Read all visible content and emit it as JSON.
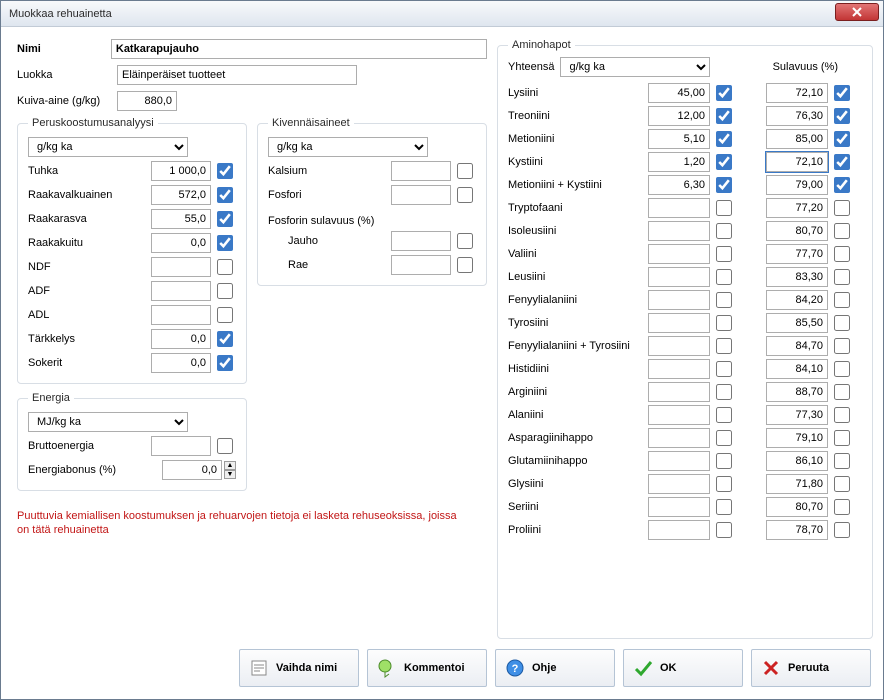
{
  "window": {
    "title": "Muokkaa rehuainetta"
  },
  "header": {
    "name_label": "Nimi",
    "class_label": "Luokka",
    "dm_label": "Kuiva-aine (g/kg)",
    "name_value": "Katkarapujauho",
    "class_value": "Eläinperäiset tuotteet",
    "dm_value": "880,0"
  },
  "basic": {
    "legend": "Peruskoostumusanalyysi",
    "unit": "g/kg ka",
    "rows": [
      {
        "label": "Tuhka",
        "val": "1 000,0",
        "chk": true
      },
      {
        "label": "Raakavalkuainen",
        "val": "572,0",
        "chk": true
      },
      {
        "label": "Raakarasva",
        "val": "55,0",
        "chk": true
      },
      {
        "label": "Raakakuitu",
        "val": "0,0",
        "chk": true
      },
      {
        "label": "NDF",
        "val": "",
        "chk": false,
        "ro": true
      },
      {
        "label": "ADF",
        "val": "",
        "chk": false,
        "ro": true
      },
      {
        "label": "ADL",
        "val": "",
        "chk": false,
        "ro": true
      },
      {
        "label": "Tärkkelys",
        "val": "0,0",
        "chk": true
      },
      {
        "label": "Sokerit",
        "val": "0,0",
        "chk": true
      }
    ]
  },
  "energy": {
    "legend": "Energia",
    "unit": "MJ/kg ka",
    "rows": [
      {
        "label": "Bruttoenergia",
        "val": "",
        "chk": false,
        "ro": true
      }
    ],
    "bonus_label": "Energiabonus (%)",
    "bonus_val": "0,0"
  },
  "minerals": {
    "legend": "Kivennäisaineet",
    "unit": "g/kg ka",
    "rows": [
      {
        "label": "Kalsium",
        "val": "",
        "chk": false,
        "ro": true
      },
      {
        "label": "Fosfori",
        "val": "",
        "chk": false,
        "ro": true
      }
    ],
    "phos_legend": "Fosforin sulavuus (%)",
    "phos_rows": [
      {
        "label": "Jauho",
        "val": "",
        "chk": false
      },
      {
        "label": "Rae",
        "val": "",
        "chk": false
      }
    ]
  },
  "amino": {
    "legend": "Aminohapot",
    "total_label": "Yhteensä",
    "total_unit": "g/kg ka",
    "sulavuus_label": "Sulavuus (%)",
    "rows": [
      {
        "label": "Lysiini",
        "val": "45,00",
        "chk": true,
        "dig": "72,10",
        "dchk": true
      },
      {
        "label": "Treoniini",
        "val": "12,00",
        "chk": true,
        "dig": "76,30",
        "dchk": true
      },
      {
        "label": "Metioniini",
        "val": "5,10",
        "chk": true,
        "dig": "85,00",
        "dchk": true
      },
      {
        "label": "Kystiini",
        "val": "1,20",
        "chk": true,
        "dig": "72,10",
        "dchk": true,
        "dig_editable": true
      },
      {
        "label": "Metioniini + Kystiini",
        "val": "6,30",
        "chk": true,
        "dig": "79,00",
        "dchk": true
      },
      {
        "label": "Tryptofaani",
        "val": "",
        "chk": false,
        "dig": "77,20",
        "dchk": false,
        "ro": true
      },
      {
        "label": "Isoleusiini",
        "val": "",
        "chk": false,
        "dig": "80,70",
        "dchk": false,
        "ro": true
      },
      {
        "label": "Valiini",
        "val": "",
        "chk": false,
        "dig": "77,70",
        "dchk": false,
        "ro": true
      },
      {
        "label": "Leusiini",
        "val": "",
        "chk": false,
        "dig": "83,30",
        "dchk": false,
        "ro": true
      },
      {
        "label": "Fenyylialaniini",
        "val": "",
        "chk": false,
        "dig": "84,20",
        "dchk": false,
        "ro": true
      },
      {
        "label": "Tyrosiini",
        "val": "",
        "chk": false,
        "dig": "85,50",
        "dchk": false,
        "ro": true
      },
      {
        "label": "Fenyylialaniini + Tyrosiini",
        "val": "",
        "chk": false,
        "dig": "84,70",
        "dchk": false,
        "ro": true
      },
      {
        "label": "Histidiini",
        "val": "",
        "chk": false,
        "dig": "84,10",
        "dchk": false,
        "ro": true
      },
      {
        "label": "Arginiini",
        "val": "",
        "chk": false,
        "dig": "88,70",
        "dchk": false,
        "ro": true
      },
      {
        "label": "Alaniini",
        "val": "",
        "chk": false,
        "dig": "77,30",
        "dchk": false,
        "ro": true
      },
      {
        "label": "Asparagiinihappo",
        "val": "",
        "chk": false,
        "dig": "79,10",
        "dchk": false,
        "ro": true
      },
      {
        "label": "Glutamiinihappo",
        "val": "",
        "chk": false,
        "dig": "86,10",
        "dchk": false,
        "ro": true
      },
      {
        "label": "Glysiini",
        "val": "",
        "chk": false,
        "dig": "71,80",
        "dchk": false,
        "ro": true
      },
      {
        "label": "Seriini",
        "val": "",
        "chk": false,
        "dig": "80,70",
        "dchk": false,
        "ro": true
      },
      {
        "label": "Proliini",
        "val": "",
        "chk": false,
        "dig": "78,70",
        "dchk": false,
        "ro": true
      }
    ]
  },
  "warning_text": "Puuttuvia kemiallisen koostumuksen ja rehuarvojen tietoja ei lasketa rehuseoksissa, joissa on tätä rehuainetta",
  "buttons": {
    "rename": "Vaihda nimi",
    "comment": "Kommentoi",
    "help": "Ohje",
    "ok": "OK",
    "cancel": "Peruuta"
  }
}
